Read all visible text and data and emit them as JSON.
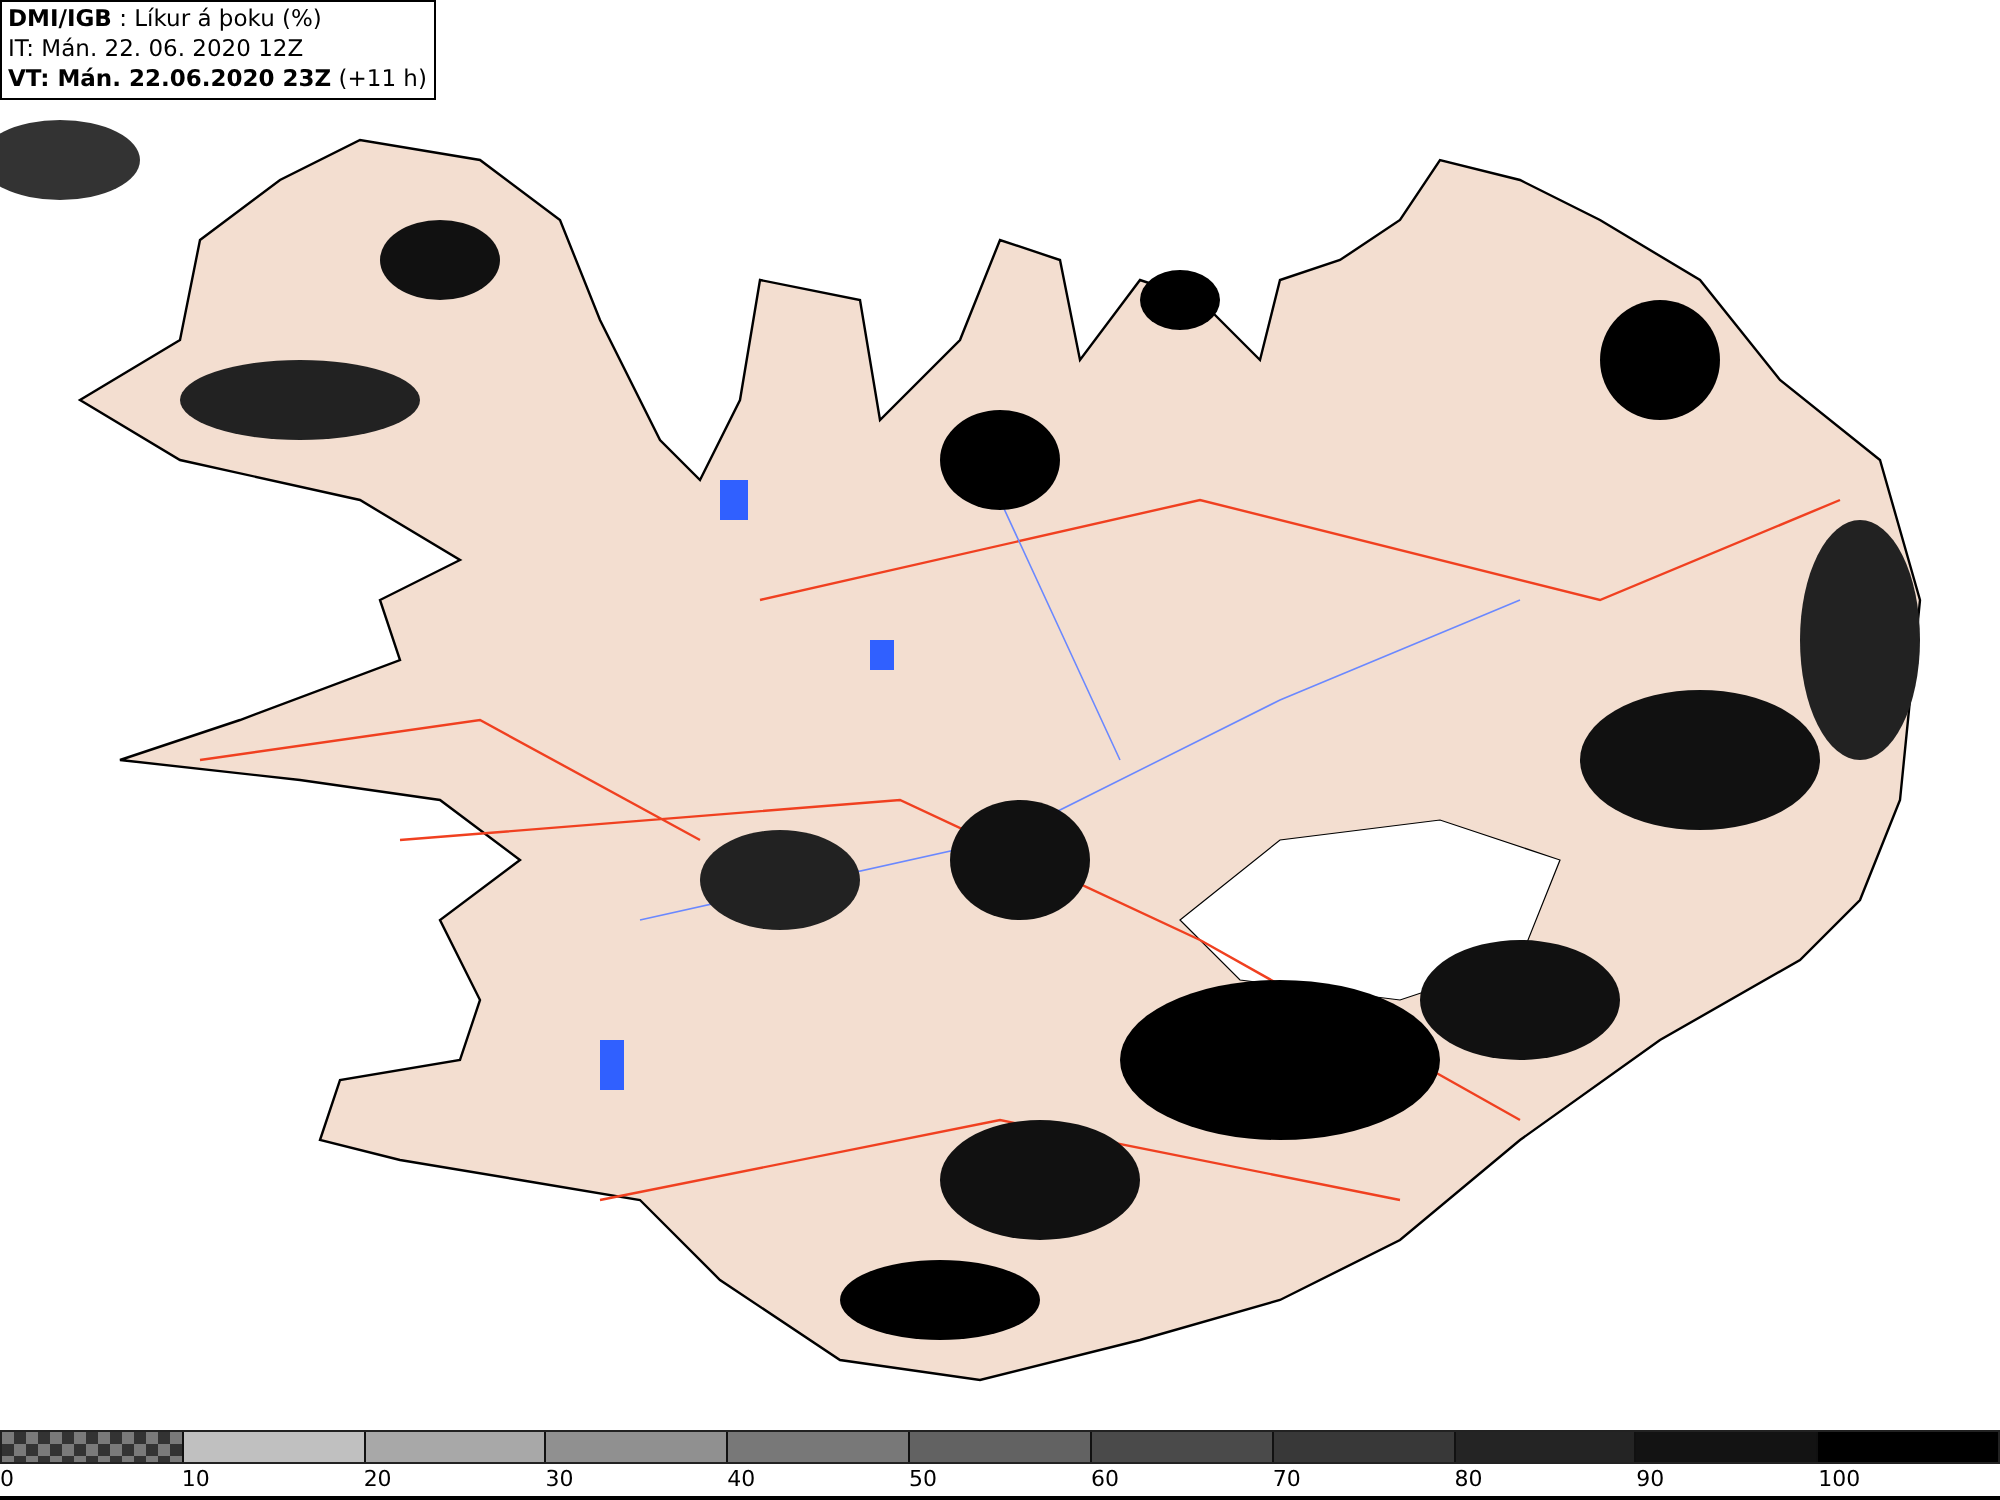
{
  "info_box": {
    "lines": [
      "**DMI/IGB** : Líkur á þoku (%)",
      "IT: Mán. 22. 06. 2020 12Z",
      "**VT: Mán. 22.06.2020 23Z** (+11 h)"
    ]
  },
  "legend": {
    "segments": [
      {
        "kind": "checker",
        "color": "#7a7a7a"
      },
      {
        "kind": "solid",
        "color": "#c0c0c0"
      },
      {
        "kind": "solid",
        "color": "#a8a8a8"
      },
      {
        "kind": "solid",
        "color": "#909090"
      },
      {
        "kind": "solid",
        "color": "#787878"
      },
      {
        "kind": "solid",
        "color": "#626262"
      },
      {
        "kind": "solid",
        "color": "#4a4a4a"
      },
      {
        "kind": "solid",
        "color": "#383838"
      },
      {
        "kind": "solid",
        "color": "#242424"
      },
      {
        "kind": "solid",
        "color": "#131313"
      },
      {
        "kind": "solid",
        "color": "#000000"
      }
    ],
    "ticks": [
      "0",
      "10",
      "20",
      "30",
      "40",
      "50",
      "60",
      "70",
      "80",
      "90",
      "100"
    ]
  }
}
